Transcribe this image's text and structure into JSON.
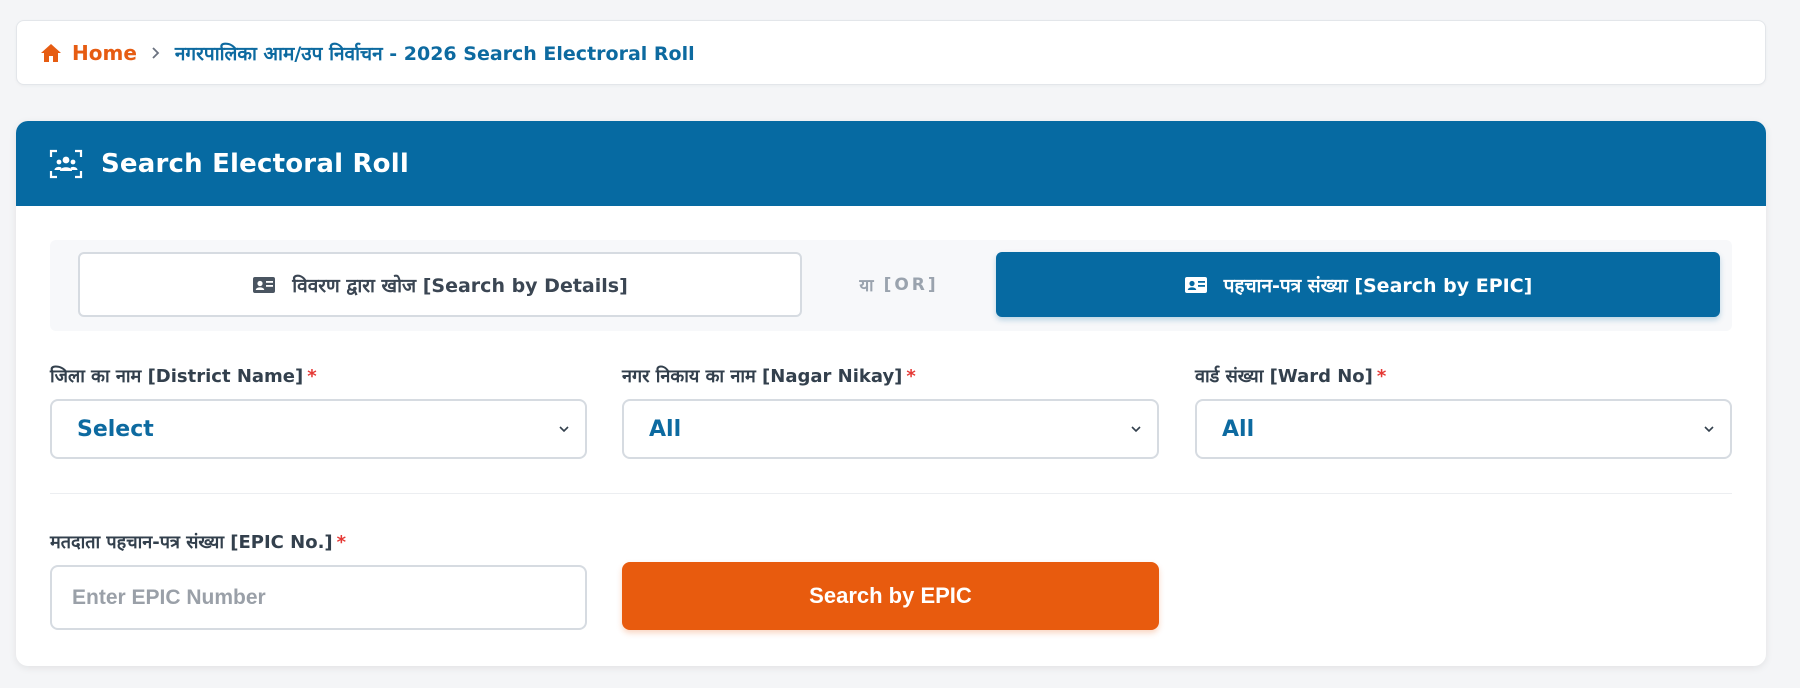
{
  "breadcrumb": {
    "home_label": "Home",
    "current": "नगरपालिका आम/उप निर्वाचन - 2026 Search Electroral Roll"
  },
  "card": {
    "title": "Search Electoral Roll",
    "header_icon": "users-scan-icon"
  },
  "search_mode": {
    "details_label": "विवरण द्वारा खोज [Search by Details]",
    "or_hi": "या",
    "or_en": "[OR]",
    "epic_label": "पहचान-पत्र संख्या [Search by EPIC]",
    "active": "epic"
  },
  "fields": {
    "district": {
      "label": "जिला का नाम [District Name]",
      "required": "*",
      "value": "Select"
    },
    "nagar_nikay": {
      "label": "नगर निकाय का नाम [Nagar Nikay]",
      "required": "*",
      "value": "All"
    },
    "ward": {
      "label": "वार्ड संख्या [Ward No]",
      "required": "*",
      "value": "All"
    },
    "epic": {
      "label": "मतदाता पहचान-पत्र संख्या [EPIC No.]",
      "required": "*",
      "value": "",
      "placeholder": "Enter EPIC Number"
    }
  },
  "actions": {
    "search_label": "Search by EPIC"
  },
  "colors": {
    "primary": "#066aa2",
    "accent": "#e85b0e",
    "required": "#e53935"
  }
}
